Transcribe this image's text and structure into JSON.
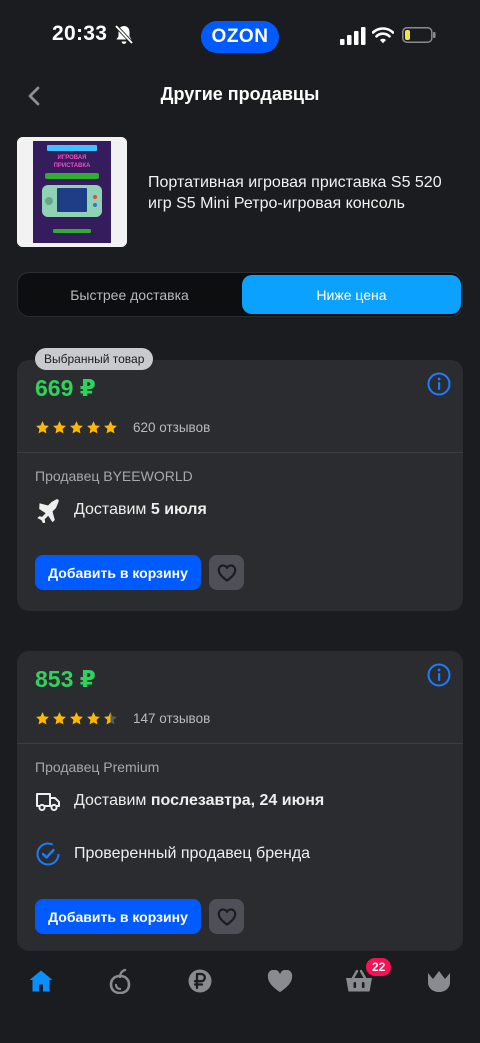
{
  "status_bar": {
    "time": "20:33",
    "brand": "OZON"
  },
  "header": {
    "title": "Другие продавцы"
  },
  "product": {
    "name": "Портативная игровая приставка S5 520 игр S5 Mini Ретро-игровая консоль",
    "thumb_title": "ПОРТАТИВНАЯ ИГРОВАЯ ПРИСТАВКА"
  },
  "tabs": [
    {
      "label": "Быстрее доставка",
      "active": false
    },
    {
      "label": "Ниже цена",
      "active": true
    }
  ],
  "offers": [
    {
      "badge": "Выбранный товар",
      "price": "669 ₽",
      "rating": 5,
      "reviews": "620 отзывов",
      "seller": "Продавец BYEEWORLD",
      "delivery_prefix": "Доставим",
      "delivery_date": "5 июля",
      "add_label": "Добавить в корзину"
    },
    {
      "price": "853 ₽",
      "rating": 4.5,
      "reviews": "147 отзывов",
      "seller": "Продавец Premium",
      "delivery_prefix": "Доставим",
      "delivery_date": "послезавтра, 24 июня",
      "verified": "Проверенный продавец бренда",
      "add_label": "Добавить в корзину"
    }
  ],
  "bottom_nav": {
    "items": [
      "home-icon",
      "fresh-icon",
      "finance-icon",
      "favorites-icon",
      "cart-icon",
      "profile-icon"
    ],
    "cart_count": "22"
  },
  "colors": {
    "accent": "#005bff",
    "price": "#2fd25a",
    "active_tab": "#0ba1ff",
    "badge": "#f91155",
    "star": "#ffb800"
  }
}
